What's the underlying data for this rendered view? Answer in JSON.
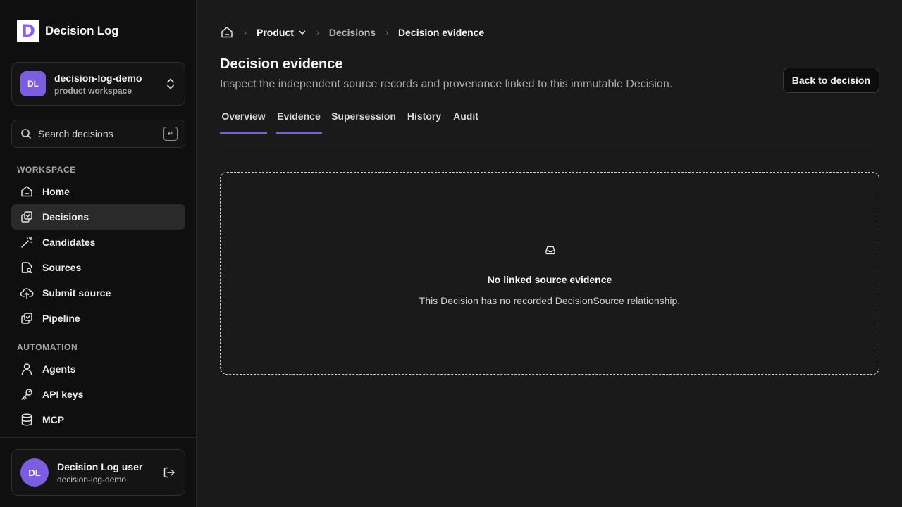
{
  "app": {
    "name": "Decision Log",
    "logo_letter": "D",
    "accent": "#7c5ce0"
  },
  "workspace": {
    "initials": "DL",
    "name": "decision-log-demo",
    "subtitle": "product workspace"
  },
  "search": {
    "label": "Search decisions",
    "shortcut": "↵"
  },
  "sidebar": {
    "sections": [
      {
        "title": "WORKSPACE",
        "items": [
          {
            "label": "Home",
            "icon": "home-icon"
          },
          {
            "label": "Decisions",
            "icon": "decisions-icon",
            "active": true
          },
          {
            "label": "Candidates",
            "icon": "magic-wand-icon"
          },
          {
            "label": "Sources",
            "icon": "file-search-icon"
          },
          {
            "label": "Submit source",
            "icon": "cloud-upload-icon"
          },
          {
            "label": "Pipeline",
            "icon": "pipeline-icon"
          }
        ]
      },
      {
        "title": "AUTOMATION",
        "items": [
          {
            "label": "Agents",
            "icon": "user-icon"
          },
          {
            "label": "API keys",
            "icon": "key-icon"
          },
          {
            "label": "MCP",
            "icon": "database-icon"
          }
        ]
      }
    ]
  },
  "user": {
    "initials": "DL",
    "name": "Decision Log user",
    "workspace": "decision-log-demo"
  },
  "breadcrumb": {
    "home_icon": "home-icon",
    "items": [
      "Product",
      "Decisions",
      "Decision evidence"
    ]
  },
  "page": {
    "title": "Decision evidence",
    "description": "Inspect the independent source records and provenance linked to this immutable Decision.",
    "back_label": "Back to decision"
  },
  "tabs": [
    "Overview",
    "Evidence",
    "Supersession",
    "History",
    "Audit"
  ],
  "empty_state": {
    "icon": "inbox-icon",
    "title": "No linked source evidence",
    "message": "This Decision has no recorded DecisionSource relationship."
  }
}
